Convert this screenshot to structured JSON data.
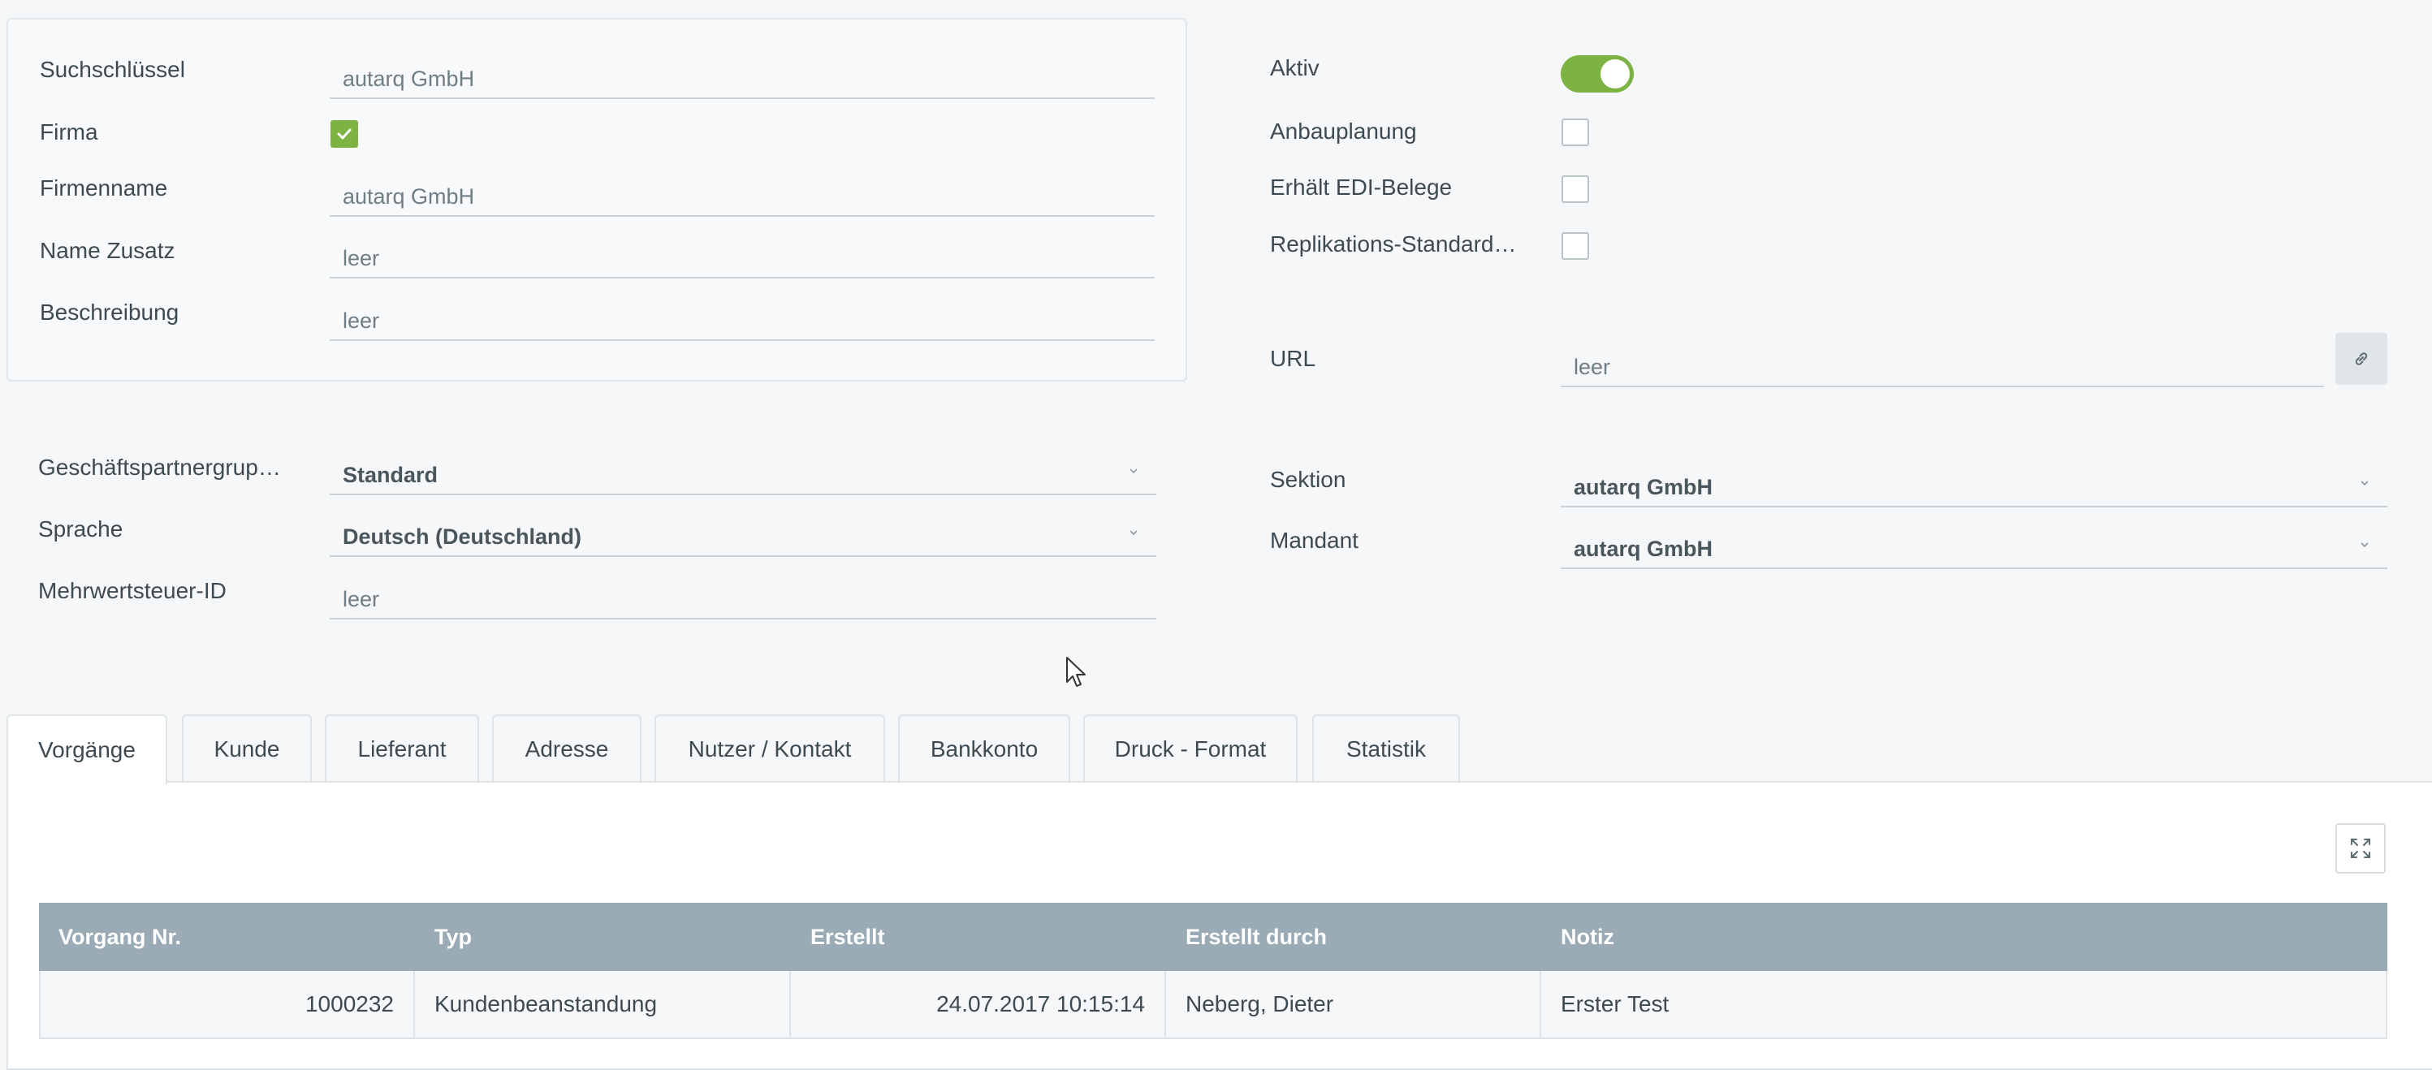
{
  "form_left": {
    "search_key": {
      "label": "Suchschlüssel",
      "value": "autarq GmbH"
    },
    "company": {
      "label": "Firma",
      "checked": true
    },
    "company_name": {
      "label": "Firmenname",
      "value": "autarq GmbH"
    },
    "name_addition": {
      "label": "Name Zusatz",
      "value": "leer"
    },
    "description": {
      "label": "Beschreibung",
      "value": "leer"
    }
  },
  "form_right": {
    "active": {
      "label": "Aktiv",
      "on": true
    },
    "cultivation_planning": {
      "label": "Anbauplanung",
      "checked": false
    },
    "edi_documents": {
      "label": "Erhält EDI-Belege",
      "checked": false
    },
    "replication_standard": {
      "label": "Replikations-Standard…",
      "checked": false
    },
    "url": {
      "label": "URL",
      "value": "leer"
    }
  },
  "form_lower_left": {
    "partner_group": {
      "label": "Geschäftspartnergrup…",
      "value": "Standard"
    },
    "language": {
      "label": "Sprache",
      "value": "Deutsch (Deutschland)"
    },
    "vat_id": {
      "label": "Mehrwertsteuer-ID",
      "value": "leer"
    }
  },
  "form_lower_right": {
    "section": {
      "label": "Sektion",
      "value": "autarq GmbH"
    },
    "client": {
      "label": "Mandant",
      "value": "autarq GmbH"
    }
  },
  "tabs": [
    {
      "label": "Vorgänge",
      "active": true
    },
    {
      "label": "Kunde"
    },
    {
      "label": "Lieferant"
    },
    {
      "label": "Adresse"
    },
    {
      "label": "Nutzer / Kontakt"
    },
    {
      "label": "Bankkonto"
    },
    {
      "label": "Druck - Format"
    },
    {
      "label": "Statistik"
    }
  ],
  "table": {
    "headers": [
      "Vorgang Nr.",
      "Typ",
      "Erstellt",
      "Erstellt durch",
      "Notiz"
    ],
    "rows": [
      [
        "1000232",
        "Kundenbeanstandung",
        "24.07.2017 10:15:14",
        "Neberg, Dieter",
        "Erster Test"
      ]
    ]
  },
  "icons": {
    "url_link": "link-icon",
    "expand": "fullscreen-icon",
    "dropdown": "chevron-down-icon"
  },
  "colors": {
    "accent_green": "#7cb342",
    "table_header": "#9aabb6",
    "row_bg": "#f5f7f8"
  }
}
